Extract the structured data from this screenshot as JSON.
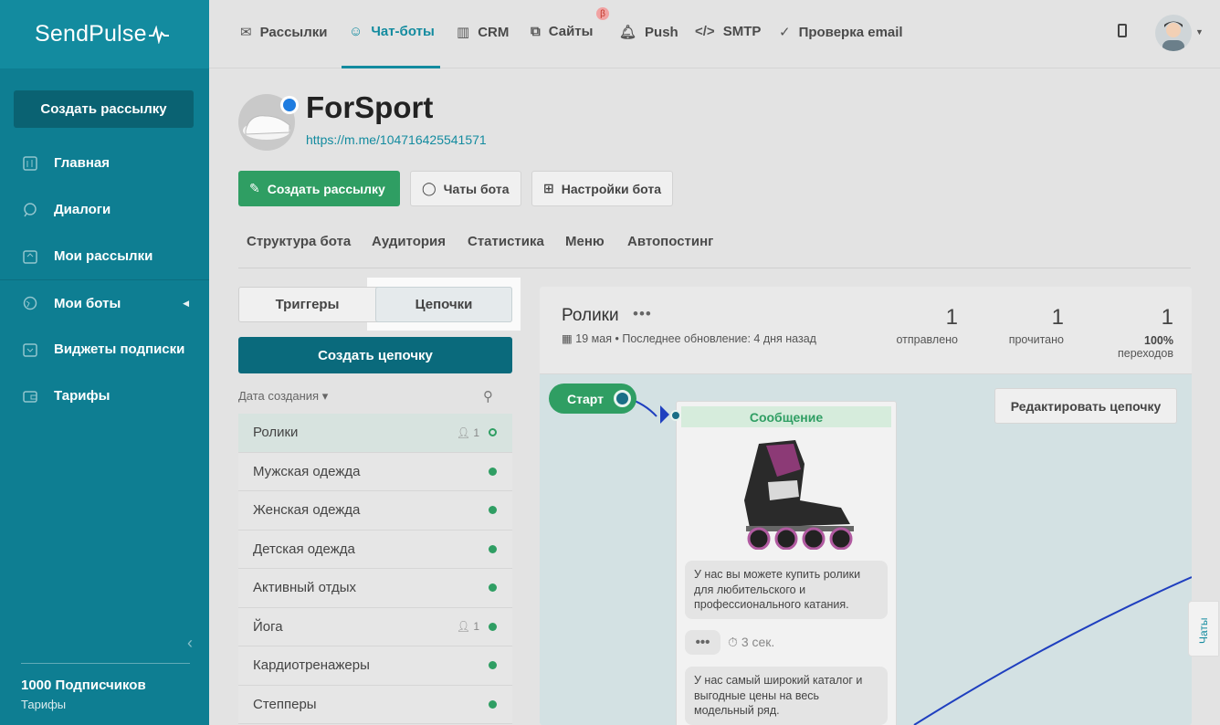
{
  "app": {
    "logo": "SendPulse",
    "sidebar_create_button": "Создать рассылку",
    "nav": [
      {
        "label": "Главная",
        "icon": "home-icon"
      },
      {
        "label": "Диалоги",
        "icon": "chat-bubble-icon"
      },
      {
        "label": "Мои рассылки",
        "icon": "campaigns-icon"
      },
      {
        "label": "Мои боты",
        "icon": "globe-icon"
      },
      {
        "label": "Виджеты подписки",
        "icon": "widget-icon"
      },
      {
        "label": "Тарифы",
        "icon": "wallet-icon"
      }
    ],
    "footer_subscribers": "1000 Подписчиков",
    "footer_tariff": "Тарифы"
  },
  "topnav": {
    "items": [
      "Рассылки",
      "Чат-боты",
      "CRM",
      "Сайты",
      "Push",
      "SMTP",
      "Проверка email"
    ],
    "active": "Чат-боты",
    "beta_badge": "β"
  },
  "bot": {
    "name": "ForSport",
    "link": "https://m.me/104716425541571",
    "buttons": {
      "create_campaign": "Создать рассылку",
      "bot_chats": "Чаты бота",
      "bot_settings": "Настройки бота"
    },
    "tabs": [
      "Структура бота",
      "Аудитория",
      "Статистика",
      "Меню",
      "Автопостинг"
    ]
  },
  "chains": {
    "segment": {
      "triggers": "Триггеры",
      "chains": "Цепочки",
      "active": "Цепочки"
    },
    "create_button": "Создать цепочку",
    "sort_label": "Дата создания",
    "list": [
      {
        "name": "Ролики",
        "count": "1",
        "selected": true
      },
      {
        "name": "Мужская одежда"
      },
      {
        "name": "Женская одежда"
      },
      {
        "name": "Детская одежда"
      },
      {
        "name": "Активный отдых"
      },
      {
        "name": "Йога",
        "count": "1"
      },
      {
        "name": "Кардиотренажеры"
      },
      {
        "name": "Степперы"
      }
    ]
  },
  "panel": {
    "title": "Ролики",
    "date": "19 мая",
    "updated": "Последнее обновление: 4 дня назад",
    "stats": {
      "sent_value": "1",
      "sent_label": "отправлено",
      "read_value": "1",
      "read_label": "прочитано",
      "clicks_value": "1",
      "clicks_pct": "100%",
      "clicks_label": "переходов"
    },
    "start_label": "Старт",
    "edit_button": "Редактировать цепочку",
    "message": {
      "header": "Сообщение",
      "text1": "У нас вы можете купить ролики для любительского и профессионального катания.",
      "delay": "3 сек.",
      "typing": "•••",
      "text2": "У нас самый широкий каталог и выгодные цены на весь модельный ряд."
    },
    "chats_tab": "Чаты"
  },
  "colors": {
    "sidebar": "#0e7e92",
    "accent": "#138b9f",
    "green": "#2f9e63"
  }
}
